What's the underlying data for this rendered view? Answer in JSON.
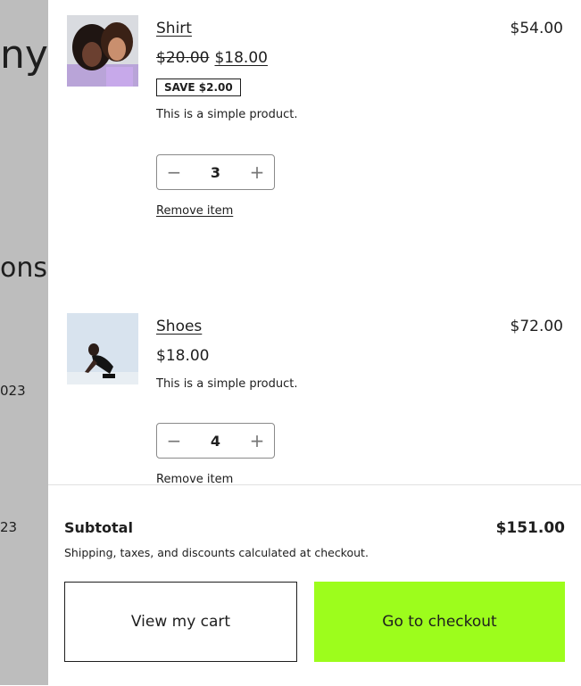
{
  "backdrop": {
    "fragments": [
      "ny",
      "ons",
      "023",
      "23"
    ]
  },
  "cart": {
    "items": [
      {
        "name": "Shirt",
        "line_total": "$54.00",
        "old_price": "$20.00",
        "price": "$18.00",
        "badge": "SAVE $2.00",
        "description": "This is a simple product.",
        "quantity": "3",
        "remove_label": "Remove item",
        "image_icon": "shirt-product-photo"
      },
      {
        "name": "Shoes",
        "line_total": "$72.00",
        "price": "$18.00",
        "description": "This is a simple product.",
        "quantity": "4",
        "remove_label": "Remove item",
        "image_icon": "shoes-product-photo"
      }
    ],
    "qty_minus_glyph": "−",
    "qty_plus_glyph": "+"
  },
  "footer": {
    "subtotal_label": "Subtotal",
    "subtotal_value": "$151.00",
    "note": "Shipping, taxes, and discounts calculated at checkout.",
    "view_cart_label": "View my cart",
    "checkout_label": "Go to checkout"
  },
  "colors": {
    "checkout_accent": "#9dfd1c",
    "backdrop": "#bdbdbd",
    "text": "#1e1e1e"
  }
}
